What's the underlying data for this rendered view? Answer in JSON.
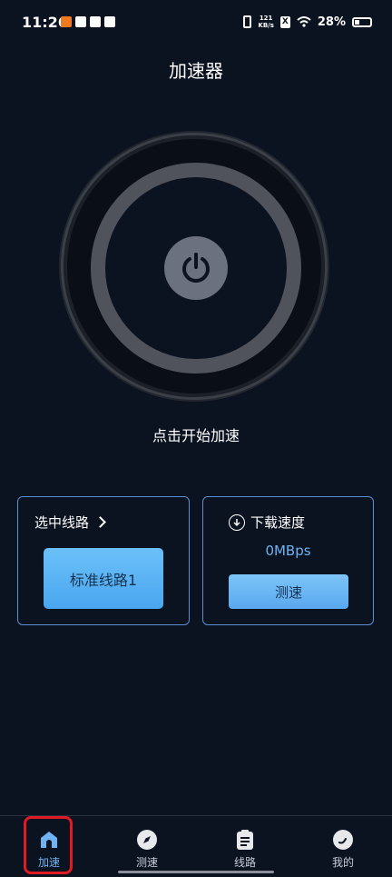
{
  "status_bar": {
    "time": "11:26",
    "net_speed_top": "121",
    "net_speed_unit": "KB/s",
    "sim_label": "X",
    "battery": "28%"
  },
  "header": {
    "title": "加速器"
  },
  "dial": {
    "hint": "点击开始加速"
  },
  "route_card": {
    "title": "选中线路",
    "selected_route": "标准线路1"
  },
  "speed_card": {
    "title": "下载速度",
    "value": "0MBps",
    "test_label": "测速"
  },
  "bottom_nav": {
    "items": [
      {
        "label": "加速",
        "icon": "home-icon",
        "active": true
      },
      {
        "label": "测速",
        "icon": "compass-icon",
        "active": false
      },
      {
        "label": "线路",
        "icon": "clipboard-icon",
        "active": false
      },
      {
        "label": "我的",
        "icon": "profile-icon",
        "active": false
      }
    ]
  },
  "colors": {
    "background": "#0b1220",
    "accent": "#6fb3f2",
    "card_border": "#5b8ed0",
    "highlight_frame": "#e01b23"
  }
}
